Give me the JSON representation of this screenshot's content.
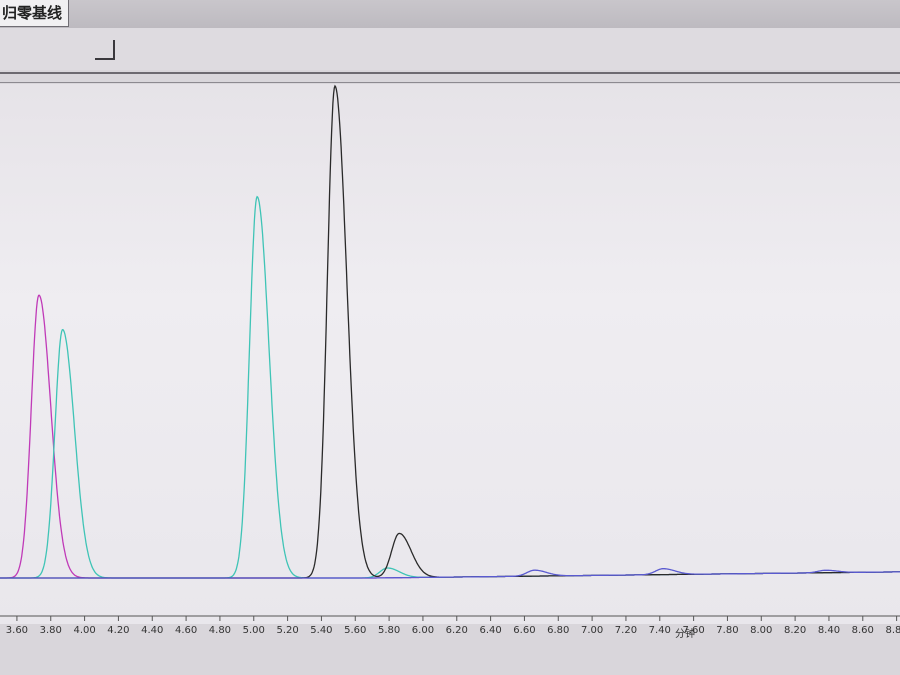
{
  "tab": {
    "label": "归零基线"
  },
  "chart_data": {
    "type": "line",
    "xlabel": "分钟",
    "xlim": [
      3.5,
      8.82
    ],
    "x_ticks": [
      "3.60",
      "3.80",
      "4.00",
      "4.20",
      "4.40",
      "4.60",
      "4.80",
      "5.00",
      "5.20",
      "5.40",
      "5.60",
      "5.80",
      "6.00",
      "6.20",
      "6.40",
      "6.60",
      "6.80",
      "7.00",
      "7.20",
      "7.40",
      "7.60",
      "7.80",
      "8.00",
      "8.20",
      "8.40",
      "8.60",
      "8.80"
    ],
    "grid": false,
    "series": [
      {
        "color": "#c03ab8",
        "peaks": [
          {
            "time": 3.73,
            "height": 0.575
          }
        ]
      },
      {
        "color": "#3fc4b6",
        "peaks": [
          {
            "time": 3.87,
            "height": 0.505
          },
          {
            "time": 5.02,
            "height": 0.775
          },
          {
            "time": 5.79,
            "height": 0.02
          }
        ]
      },
      {
        "color": "#2a2a2a",
        "peaks": [
          {
            "time": 5.48,
            "height": 1.0
          },
          {
            "time": 5.86,
            "height": 0.09
          }
        ]
      },
      {
        "color": "#5a5ad0",
        "peaks": [
          {
            "time": 6.66,
            "height": 0.012
          },
          {
            "time": 7.42,
            "height": 0.012
          },
          {
            "time": 8.38,
            "height": 0.005
          }
        ]
      }
    ]
  }
}
